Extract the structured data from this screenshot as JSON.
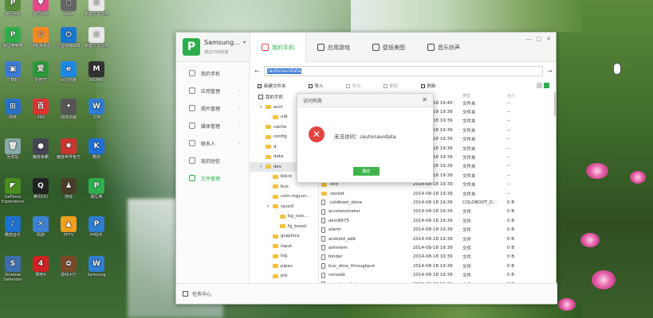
{
  "desktop": {
    "icons": [
      {
        "label": "快压手机",
        "color": "#5a8c3a",
        "glyph": "P"
      },
      {
        "label": "快压助手",
        "color": "#e24a8a",
        "glyph": "♥"
      },
      {
        "label": "clean",
        "color": "#666",
        "glyph": "◻"
      },
      {
        "label": "新建文本文档",
        "color": "#e8e8e8",
        "glyph": "≡"
      },
      {
        "label": "豌豆荚苹果",
        "color": "#2fae4e",
        "glyph": "P"
      },
      {
        "label": "快吧游戏盒",
        "color": "#ff8a1f",
        "glyph": "☺"
      },
      {
        "label": "迅雷快速卸载",
        "color": "#1976d2",
        "glyph": "⏻"
      },
      {
        "label": "新建文本文档",
        "color": "#e8e8e8",
        "glyph": "≡"
      },
      {
        "label": "计算机",
        "color": "#3d7ad6",
        "glyph": "▣"
      },
      {
        "label": "爱奇艺",
        "color": "#2a9a3a",
        "glyph": "爱"
      },
      {
        "label": "ie浏览器",
        "color": "#1e88e5",
        "glyph": "e"
      },
      {
        "label": "NISMW",
        "color": "#333",
        "glyph": "M"
      },
      {
        "label": "网络",
        "color": "#2b6fc7",
        "glyph": "⊞"
      },
      {
        "label": "360",
        "color": "#d33",
        "glyph": "百"
      },
      {
        "label": "网游加速",
        "color": "#555",
        "glyph": "✦"
      },
      {
        "label": "文档",
        "color": "#2e7dd1",
        "glyph": "W"
      },
      {
        "label": "回收站",
        "color": "#8aa",
        "glyph": "🗑"
      },
      {
        "label": "魔兽争霸",
        "color": "#445",
        "glyph": "●"
      },
      {
        "label": "魔兽世界官方",
        "color": "#c33",
        "glyph": "✺"
      },
      {
        "label": "酷狗",
        "color": "#1e6fd6",
        "glyph": "K"
      },
      {
        "label": "GeForce Experience",
        "color": "#4b8c1f",
        "glyph": "◤"
      },
      {
        "label": "腾讯QQ",
        "color": "#222",
        "glyph": "Q"
      },
      {
        "label": "游戏",
        "color": "#4a3d2a",
        "glyph": "♟"
      },
      {
        "label": "豌豆荚",
        "color": "#2fae4e",
        "glyph": "P"
      },
      {
        "label": "酷狗音乐",
        "color": "#1e6fd6",
        "glyph": "♪"
      },
      {
        "label": "网游",
        "color": "#3a82d1",
        "glyph": "✕"
      },
      {
        "label": "PPTV",
        "color": "#f0a020",
        "glyph": "▲"
      },
      {
        "label": "PP助手",
        "color": "#2e7dd1",
        "glyph": "P"
      },
      {
        "label": "Shadow Defender",
        "color": "#3d6fb0",
        "glyph": "S"
      },
      {
        "label": "网吧4",
        "color": "#c22",
        "glyph": "4"
      },
      {
        "label": "游戏大厅",
        "color": "#7a4a2a",
        "glyph": "✿"
      },
      {
        "label": "Samsung",
        "color": "#2e7dd1",
        "glyph": "W"
      }
    ]
  },
  "window": {
    "device_name": "Samsung...",
    "device_sub": "通过USB连接",
    "tabs": [
      "我的手机",
      "应用游戏",
      "壁纸美图",
      "音乐铃声"
    ],
    "controls": [
      "—",
      "□",
      "✕"
    ],
    "sidebar": [
      {
        "label": "我的手机",
        "arrow": ""
      },
      {
        "label": "应用管理",
        "arrow": "⌄"
      },
      {
        "label": "照片管理",
        "arrow": "⌄"
      },
      {
        "label": "媒体管理",
        "arrow": "⌄"
      },
      {
        "label": "联系人",
        "arrow": "⌄"
      },
      {
        "label": "我的短信",
        "arrow": ""
      },
      {
        "label": "文件管理",
        "arrow": ""
      }
    ],
    "task_center": "任务中心",
    "address": {
      "back": "←",
      "forward": "→",
      "path": "/autonavidata"
    },
    "toolbar": [
      {
        "label": "新建文件夹",
        "disabled": false
      },
      {
        "label": "导入",
        "disabled": false
      },
      {
        "label": "导出",
        "disabled": true
      },
      {
        "label": "删除",
        "disabled": true
      },
      {
        "label": "刷新",
        "disabled": false
      }
    ],
    "tree": [
      {
        "label": "我的手机",
        "level": 0,
        "toggle": "",
        "type": "pc"
      },
      {
        "label": "acct",
        "level": 1,
        "toggle": "▾"
      },
      {
        "label": "uid",
        "level": 2,
        "toggle": ""
      },
      {
        "label": "cache",
        "level": 1,
        "toggle": ""
      },
      {
        "label": "config",
        "level": 1,
        "toggle": ""
      },
      {
        "label": "d",
        "level": 1,
        "toggle": ""
      },
      {
        "label": "data",
        "level": 1,
        "toggle": ""
      },
      {
        "label": "dev",
        "level": 1,
        "toggle": "▾",
        "selected": true
      },
      {
        "label": "block",
        "level": 2,
        "toggle": ""
      },
      {
        "label": "bus",
        "level": 2,
        "toggle": ""
      },
      {
        "label": "com.mgyun...",
        "level": 2,
        "toggle": ""
      },
      {
        "label": "cpuctl",
        "level": 2,
        "toggle": "▾"
      },
      {
        "label": "bg_non...",
        "level": 3,
        "toggle": ""
      },
      {
        "label": "fg_boost",
        "level": 3,
        "toggle": ""
      },
      {
        "label": "graphics",
        "level": 2,
        "toggle": ""
      },
      {
        "label": "input",
        "level": 2,
        "toggle": ""
      },
      {
        "label": "log",
        "level": 2,
        "toggle": ""
      },
      {
        "label": "pipes",
        "level": 2,
        "toggle": ""
      },
      {
        "label": "pts",
        "level": 2,
        "toggle": ""
      },
      {
        "label": "snd",
        "level": 2,
        "toggle": ""
      }
    ],
    "list_headers": [
      "名称",
      "修改时间",
      "类型",
      "大小"
    ],
    "rows": [
      {
        "name": "",
        "date": "2014-08-18 19:40",
        "type": "文件夹",
        "size": "--",
        "doc": false
      },
      {
        "name": "",
        "date": "2014-08-18 19:39",
        "type": "文件夹",
        "size": "--",
        "doc": false
      },
      {
        "name": "",
        "date": "2014-08-18 19:39",
        "type": "文件夹",
        "size": "--",
        "doc": false
      },
      {
        "name": "",
        "date": "2014-08-18 19:39",
        "type": "文件夹",
        "size": "--",
        "doc": false
      },
      {
        "name": "",
        "date": "2014-08-18 19:39",
        "type": "文件夹",
        "size": "--",
        "doc": false
      },
      {
        "name": "",
        "date": "2014-08-18 19:39",
        "type": "文件夹",
        "size": "--",
        "doc": false
      },
      {
        "name": "",
        "date": "2014-08-18 19:39",
        "type": "文件夹",
        "size": "--",
        "doc": false
      },
      {
        "name": "",
        "date": "2014-08-18 19:39",
        "type": "文件夹",
        "size": "--",
        "doc": false
      },
      {
        "name": "",
        "date": "2014-08-18 19:39",
        "type": "文件夹",
        "size": "--",
        "doc": false
      },
      {
        "name": "snd",
        "date": "2014-08-18 19:39",
        "type": "文件夹",
        "size": "--",
        "doc": false
      },
      {
        "name": "socket",
        "date": "2014-08-18 19:39",
        "type": "文件夹",
        "size": "--",
        "doc": false
      },
      {
        "name": ".coldboot_done",
        "date": "2014-08-18 19:39",
        "type": "COLDBOOT_D...",
        "size": "0 B",
        "doc": true
      },
      {
        "name": "accelerometer",
        "date": "2014-08-18 19:39",
        "type": "文件",
        "size": "0 B",
        "doc": true
      },
      {
        "name": "akm8975",
        "date": "2014-08-18 19:39",
        "type": "文件",
        "size": "0 B",
        "doc": true
      },
      {
        "name": "alarm",
        "date": "2014-08-18 19:39",
        "type": "文件",
        "size": "0 B",
        "doc": true
      },
      {
        "name": "android_adb",
        "date": "2014-08-18 19:39",
        "type": "文件",
        "size": "0 B",
        "doc": true
      },
      {
        "name": "ashmem",
        "date": "2014-08-18 19:39",
        "type": "文件",
        "size": "0 B",
        "doc": true
      },
      {
        "name": "binder",
        "date": "2014-08-18 19:39",
        "type": "文件",
        "size": "0 B",
        "doc": true
      },
      {
        "name": "bus_dma_throughput",
        "date": "2014-08-18 19:39",
        "type": "文件",
        "size": "0 B",
        "doc": true
      },
      {
        "name": "console",
        "date": "2014-08-18 19:39",
        "type": "文件",
        "size": "0 B",
        "doc": true
      },
      {
        "name": "cpu_dma_latency",
        "date": "2014-08-18 19:39",
        "type": "文件",
        "size": "0 B",
        "doc": true
      }
    ]
  },
  "dialog": {
    "title": "访问失败",
    "close": "✕",
    "icon": "✕",
    "message": "无法访问：/autonavidata",
    "ok": "确定"
  }
}
